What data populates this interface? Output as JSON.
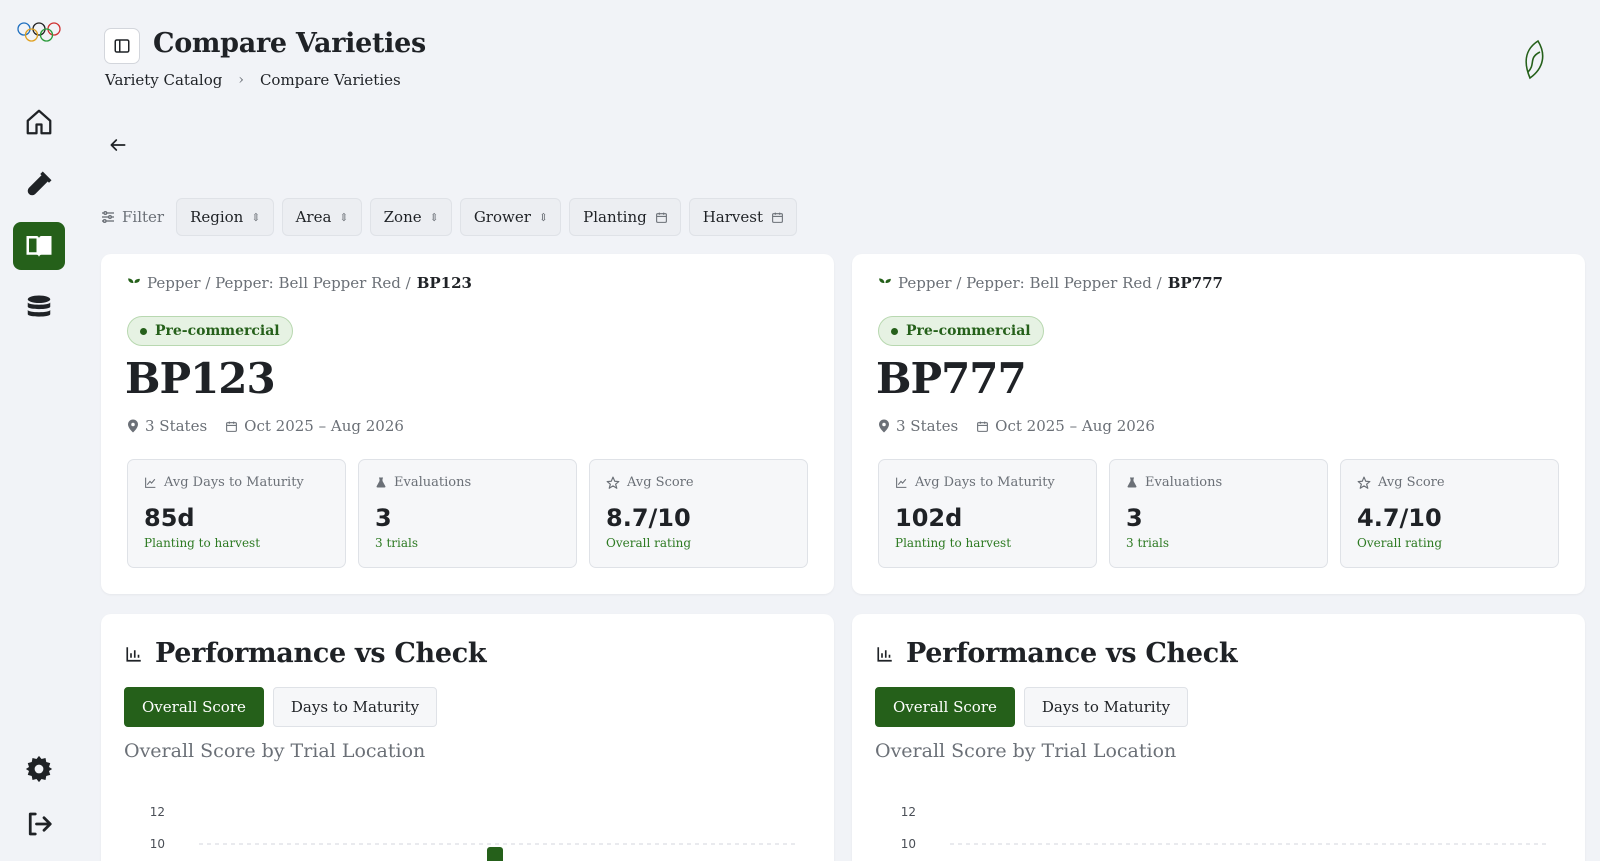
{
  "header": {
    "title": "Compare Varieties",
    "breadcrumb": [
      "Variety Catalog",
      "Compare Varieties"
    ]
  },
  "filter": {
    "label": "Filter",
    "chips": [
      {
        "label": "Region",
        "icon": "chevron-updown-icon"
      },
      {
        "label": "Area",
        "icon": "chevron-updown-icon"
      },
      {
        "label": "Zone",
        "icon": "chevron-updown-icon"
      },
      {
        "label": "Grower",
        "icon": "chevron-updown-icon"
      },
      {
        "label": "Planting",
        "icon": "calendar-icon"
      },
      {
        "label": "Harvest",
        "icon": "calendar-icon"
      }
    ]
  },
  "colors": {
    "accent": "#25601a",
    "status_bg": "#e6f2e3",
    "page_bg": "#f1f3f7"
  },
  "varieties": [
    {
      "crumb_prefix": "Pepper / Pepper: Bell Pepper Red /",
      "crumb_name": "BP123",
      "status": "Pre-commercial",
      "name": "BP123",
      "states": "3 States",
      "dates": "Oct 2025 – Aug 2026",
      "stats": [
        {
          "label": "Avg Days to Maturity",
          "value": "85d",
          "sub": "Planting to harvest"
        },
        {
          "label": "Evaluations",
          "value": "3",
          "sub": "3 trials"
        },
        {
          "label": "Avg Score",
          "value": "8.7/10",
          "sub": "Overall rating"
        }
      ]
    },
    {
      "crumb_prefix": "Pepper / Pepper: Bell Pepper Red /",
      "crumb_name": "BP777",
      "status": "Pre-commercial",
      "name": "BP777",
      "states": "3 States",
      "dates": "Oct 2025 – Aug 2026",
      "stats": [
        {
          "label": "Avg Days to Maturity",
          "value": "102d",
          "sub": "Planting to harvest"
        },
        {
          "label": "Evaluations",
          "value": "3",
          "sub": "3 trials"
        },
        {
          "label": "Avg Score",
          "value": "4.7/10",
          "sub": "Overall rating"
        }
      ]
    }
  ],
  "performance": {
    "title": "Performance vs Check",
    "tabs": [
      "Overall Score",
      "Days to Maturity"
    ],
    "active_tab": "Overall Score",
    "chart_subtitle": "Overall Score by Trial Location"
  },
  "chart_data": [
    {
      "type": "bar",
      "y_ticks": [
        12,
        10
      ],
      "ylim": [
        0,
        12
      ],
      "grid": true,
      "visible_bar_top": 10
    },
    {
      "type": "bar",
      "y_ticks": [
        12,
        10
      ],
      "ylim": [
        0,
        12
      ],
      "grid": true
    }
  ]
}
